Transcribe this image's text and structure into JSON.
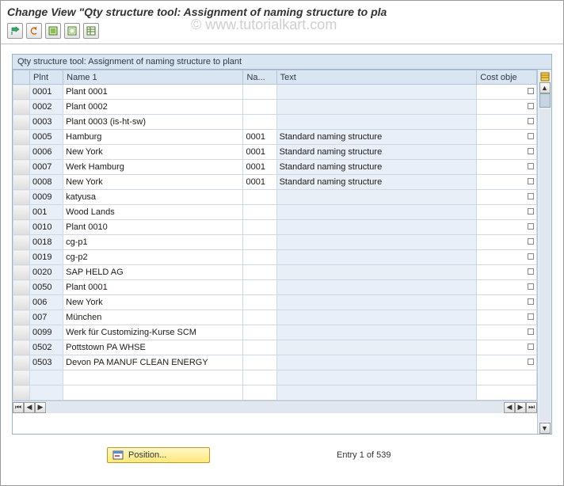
{
  "title": "Change View \"Qty structure tool: Assignment of naming structure to pla",
  "watermark": "© www.tutorialkart.com",
  "grid": {
    "caption": "Qty structure tool: Assignment of naming structure to plant",
    "columns": {
      "plnt": "Plnt",
      "name1": "Name 1",
      "na": "Na...",
      "text": "Text",
      "cost": "Cost obje"
    },
    "rows": [
      {
        "plnt": "0001",
        "name1": "Plant 0001",
        "na": "",
        "text": ""
      },
      {
        "plnt": "0002",
        "name1": "Plant 0002",
        "na": "",
        "text": ""
      },
      {
        "plnt": "0003",
        "name1": "Plant 0003 (is-ht-sw)",
        "na": "",
        "text": ""
      },
      {
        "plnt": "0005",
        "name1": "Hamburg",
        "na": "0001",
        "text": "Standard naming structure"
      },
      {
        "plnt": "0006",
        "name1": "New York",
        "na": "0001",
        "text": "Standard naming structure"
      },
      {
        "plnt": "0007",
        "name1": "Werk Hamburg",
        "na": "0001",
        "text": "Standard naming structure"
      },
      {
        "plnt": "0008",
        "name1": "New York",
        "na": "0001",
        "text": "Standard naming structure"
      },
      {
        "plnt": "0009",
        "name1": "katyusa",
        "na": "",
        "text": ""
      },
      {
        "plnt": "001",
        "name1": "Wood Lands",
        "na": "",
        "text": ""
      },
      {
        "plnt": "0010",
        "name1": "Plant 0010",
        "na": "",
        "text": ""
      },
      {
        "plnt": "0018",
        "name1": "cg-p1",
        "na": "",
        "text": ""
      },
      {
        "plnt": "0019",
        "name1": "cg-p2",
        "na": "",
        "text": ""
      },
      {
        "plnt": "0020",
        "name1": "SAP HELD AG",
        "na": "",
        "text": ""
      },
      {
        "plnt": "0050",
        "name1": "Plant 0001",
        "na": "",
        "text": ""
      },
      {
        "plnt": "006",
        "name1": "New York",
        "na": "",
        "text": ""
      },
      {
        "plnt": "007",
        "name1": "München",
        "na": "",
        "text": ""
      },
      {
        "plnt": "0099",
        "name1": "Werk für Customizing-Kurse SCM",
        "na": "",
        "text": ""
      },
      {
        "plnt": "0502",
        "name1": "Pottstown PA WHSE",
        "na": "",
        "text": ""
      },
      {
        "plnt": "0503",
        "name1": "Devon PA MANUF CLEAN ENERGY",
        "na": "",
        "text": ""
      }
    ]
  },
  "footer": {
    "position_label": "Position...",
    "entry_text": "Entry 1 of 539"
  }
}
